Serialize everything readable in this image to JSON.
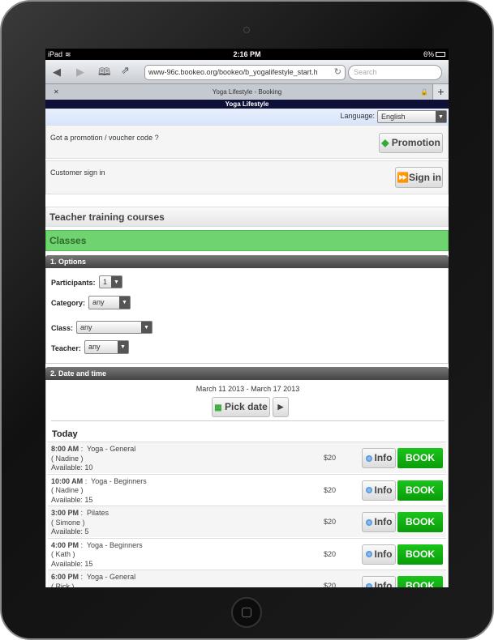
{
  "status": {
    "device": "iPad",
    "time": "2:16 PM",
    "battery": "6%"
  },
  "browser": {
    "url": "www-96c.bookeo.org/bookeo/b_yogalifestyle_start.h",
    "search_placeholder": "Search",
    "tab_title": "Yoga Lifestyle - Booking"
  },
  "site": {
    "title": "Yoga Lifestyle",
    "language_label": "Language:",
    "language": "English"
  },
  "promo": {
    "text": "Got a promotion / voucher code ?",
    "button": "Promotion"
  },
  "signin": {
    "text": "Customer sign in",
    "button": "Sign in"
  },
  "sections": {
    "teacher": "Teacher training courses",
    "classes": "Classes"
  },
  "options": {
    "header": "1. Options",
    "participants_label": "Participants:",
    "participants": "1",
    "category_label": "Category:",
    "category": "any",
    "class_label": "Class:",
    "class": "any",
    "teacher_label": "Teacher:",
    "teacher": "any"
  },
  "datetime": {
    "header": "2. Date and time",
    "range": "March 11 2013 - March 17 2013",
    "pick": "Pick date",
    "day": "Today"
  },
  "slots": [
    {
      "time": "8:00 AM",
      "name": "Yoga - General",
      "teacher": "( Nadine )",
      "available": "Available: 10",
      "price": "$20"
    },
    {
      "time": "10:00 AM",
      "name": "Yoga - Beginners",
      "teacher": "( Nadine )",
      "available": "Available: 15",
      "price": "$20"
    },
    {
      "time": "3:00 PM",
      "name": "Pilates",
      "teacher": "( Simone )",
      "available": "Available: 5",
      "price": "$20"
    },
    {
      "time": "4:00 PM",
      "name": "Yoga - Beginners",
      "teacher": "( Kath )",
      "available": "Available: 15",
      "price": "$20"
    },
    {
      "time": "6:00 PM",
      "name": "Yoga - General",
      "teacher": "( Rick )",
      "available": "",
      "price": "$20"
    }
  ],
  "labels": {
    "info": "Info",
    "book": "BOOK"
  },
  "colors": {
    "accent_green": "#0aa80a",
    "classes_bar": "#6fd36f",
    "header_navy": "#0f1038"
  }
}
